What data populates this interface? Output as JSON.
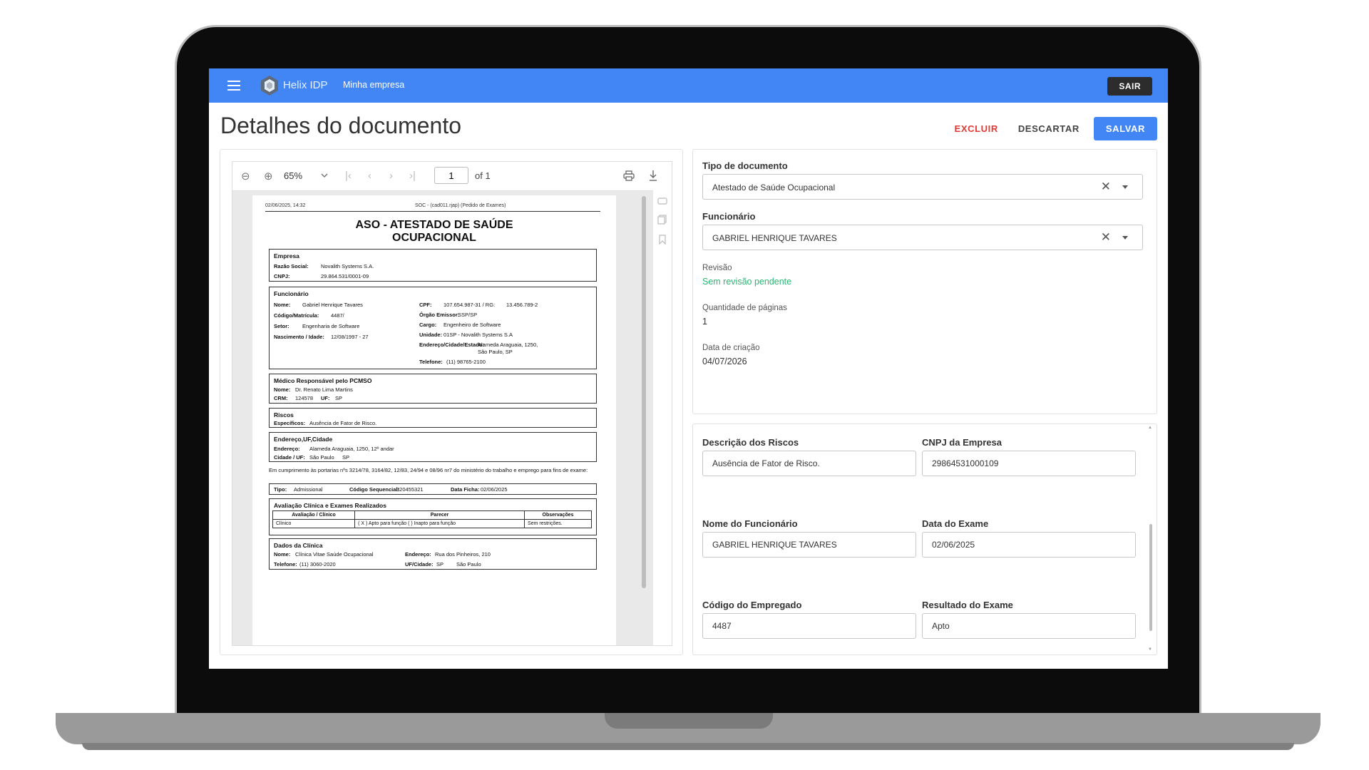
{
  "app": {
    "brand": "Helix IDP",
    "company": "Minha empresa",
    "logout_label": "SAIR",
    "accent": "#4285f4"
  },
  "page": {
    "title": "Detalhes do documento",
    "actions": {
      "delete": "EXCLUIR",
      "discard": "DESCARTAR",
      "save": "SALVAR"
    }
  },
  "viewer": {
    "zoom": "65%",
    "page_current": "1",
    "page_total": "of 1"
  },
  "document": {
    "header_left": "02/06/2025, 14:32",
    "header_right": "SOC - (cad011.rjap) (Pedido de Exames)",
    "title_line1": "ASO - ATESTADO DE SAÚDE",
    "title_line2": "OCUPACIONAL",
    "empresa": {
      "heading": "Empresa",
      "razao_label": "Razão Social:",
      "razao_value": "Novalith Systems S.A.",
      "cnpj_label": "CNPJ:",
      "cnpj_value": "29.864.531/0001-09"
    },
    "funcionario": {
      "heading": "Funcionário",
      "nome_label": "Nome:",
      "nome_value": "Gabriel Henrique Tavares",
      "codigo_label": "Código/Matrícula:",
      "codigo_value": "4487/",
      "setor_label": "Setor:",
      "setor_value": "Engenharia de Software",
      "nasc_label": "Nascimento / Idade:",
      "nasc_value": "12/08/1997 - 27",
      "cpf_label": "CPF:",
      "cpf_value": "107.654.987-31 / RG:",
      "rg_value": "13.456.789-2",
      "orgao_label": "Órgão Emissor:",
      "orgao_value": "SSP/SP",
      "cargo_label": "Cargo:",
      "cargo_value": "Engenheiro de Software",
      "unidade_label": "Unidade:",
      "unidade_value": "01SP - Novalith Systems S.A",
      "end_label": "Endereço/Cidade/Estado:",
      "end_value1": "Alameda Araguaia, 1250,",
      "end_value2": "São Paulo, SP",
      "tel_label": "Telefone:",
      "tel_value": "(11) 98765-2100"
    },
    "medico": {
      "heading": "Médico Responsável pelo PCMSO",
      "nome_label": "Nome:",
      "nome_value": "Dr. Renato Lima Martins",
      "crm_label": "CRM:",
      "crm_value": "124578",
      "uf_label": "UF:",
      "uf_value": "SP"
    },
    "riscos": {
      "heading": "Riscos",
      "esp_label": "Específicos:",
      "esp_value": "Ausência de Fator de Risco."
    },
    "endereco": {
      "heading": "Endereço,UF,Cidade",
      "end_label": "Endereço:",
      "end_value": "Alameda Araguaia, 1250, 12º andar",
      "cid_label": "Cidade / UF:",
      "cid_value": "São Paulo",
      "cid_uf": "SP"
    },
    "paragraph": "Em cumprimento às portarias nºs 3214/78, 3164/82, 12/83, 24/94 e 08/96 nr7 do ministério do trabalho e emprego para fins de exame:",
    "exame": {
      "tipo_label": "Tipo:",
      "tipo_value": "Admissional",
      "seq_label": "Código Sequencial:",
      "seq_value": "320455321",
      "data_label": "Data Ficha:",
      "data_value": "02/06/2025"
    },
    "avaliacao": {
      "heading": "Avaliação Clínica e Exames Realizados",
      "col1": "Avaliação / Clínico",
      "col2": "Parecer",
      "col3": "Observações",
      "c1": "Clínico",
      "c2a": "( X ) Apto para função",
      "c2b": "(   ) Inapto para função",
      "c3": "Sem restrições."
    },
    "clinica": {
      "heading": "Dados da Clínica",
      "nome_label": "Nome:",
      "nome_value": "Clínica Vitae Saúde Ocupacional",
      "end_label": "Endereço:",
      "end_value": "Rua dos Pinheiros, 210",
      "tel_label": "Telefone:",
      "tel_value": "(11) 3060-2020",
      "uf_label": "UF/Cidade:",
      "uf_value": "SP",
      "cidade_value": "São Paulo"
    }
  },
  "info": {
    "tipo_label": "Tipo de documento",
    "tipo_value": "Atestado de Saúde Ocupacional",
    "func_label": "Funcionário",
    "func_value": "GABRIEL HENRIQUE TAVARES",
    "revisao_label": "Revisão",
    "revisao_value": "Sem revisão pendente",
    "paginas_label": "Quantidade de páginas",
    "paginas_value": "1",
    "criacao_label": "Data de criação",
    "criacao_value": "04/07/2026"
  },
  "fields": {
    "riscos_label": "Descrição dos Riscos",
    "riscos_value": "Ausência de Fator de Risco.",
    "cnpj_label": "CNPJ da Empresa",
    "cnpj_value": "29864531000109",
    "nome_label": "Nome do Funcionário",
    "nome_value": "GABRIEL HENRIQUE TAVARES",
    "data_label": "Data do Exame",
    "data_value": "02/06/2025",
    "codigo_label": "Código do Empregado",
    "codigo_value": "4487",
    "resultado_label": "Resultado do Exame",
    "resultado_value": "Apto"
  }
}
